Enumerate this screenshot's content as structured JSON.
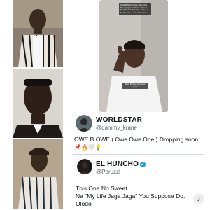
{
  "video": {
    "caption_overlay": "Owe B Owe | Owe Owe One | Dropping soon Fans react as Davido and Peruzzi ... this go be the one ... one more time ...",
    "subcaption_overlay": "Owe B Owe dropping soon"
  },
  "tweet1": {
    "display_name": "WORLDSTAR",
    "handle": "@dammy_krane",
    "text": "OWE B OWE ( Owe Owe One ) Dropping soon",
    "emojis": "📌🔥🤍💡"
  },
  "tweet2": {
    "display_name": "EL HUNCHO",
    "verified_mark": "✓",
    "handle": "@Peruzzi",
    "line1": "This One No Sweet.",
    "line2": "Na \"My Life Jaga Jaga\" You Suppose Do.",
    "line3": "Olodo"
  },
  "watermark": {
    "glyph": "♪"
  },
  "colors": {
    "verified_blue": "#1d9bf0",
    "handle_gray": "#536471"
  }
}
